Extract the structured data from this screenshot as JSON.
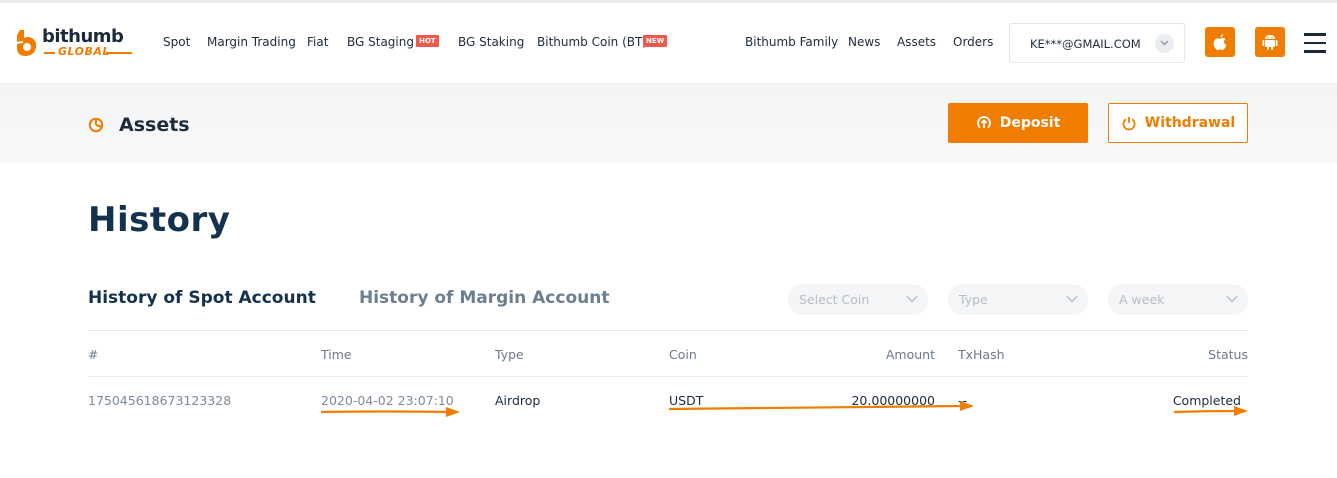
{
  "brand": {
    "name": "bithumb",
    "sub": "GLOBAL",
    "accent": "#f07c00",
    "dark": "#14324f"
  },
  "nav": {
    "left": [
      {
        "label": "Spot"
      },
      {
        "label": "Margin Trading"
      },
      {
        "label": "Fiat"
      },
      {
        "label": "BG Staging",
        "badge": "HOT"
      },
      {
        "label": "BG Staking"
      },
      {
        "label": "Bithumb Coin (BT)",
        "badge": "NEW"
      }
    ],
    "right": [
      {
        "label": "Bithumb Family"
      },
      {
        "label": "News"
      },
      {
        "label": "Assets"
      },
      {
        "label": "Orders"
      }
    ],
    "account_email": "KE***@GMAIL.COM",
    "icons": [
      "apple-icon",
      "android-icon",
      "hamburger-menu-icon"
    ]
  },
  "assets_bar": {
    "title": "Assets",
    "deposit_label": "Deposit",
    "withdraw_label": "Withdrawal"
  },
  "history": {
    "title": "History",
    "tabs": [
      {
        "label": "History of Spot Account",
        "active": true
      },
      {
        "label": "History of Margin Account",
        "active": false
      }
    ],
    "filters": {
      "coin_placeholder": "Select Coin",
      "type_placeholder": "Type",
      "period_placeholder": "A week"
    },
    "columns": [
      "#",
      "Time",
      "Type",
      "Coin",
      "Amount",
      "TxHash",
      "Status"
    ],
    "rows": [
      {
        "id": "1750456186731233​28",
        "time": "2020-04-02 23:07:10",
        "type": "Airdrop",
        "coin": "USDT",
        "amount": "20.00000000",
        "txhash": "--",
        "status": "Completed"
      }
    ]
  }
}
